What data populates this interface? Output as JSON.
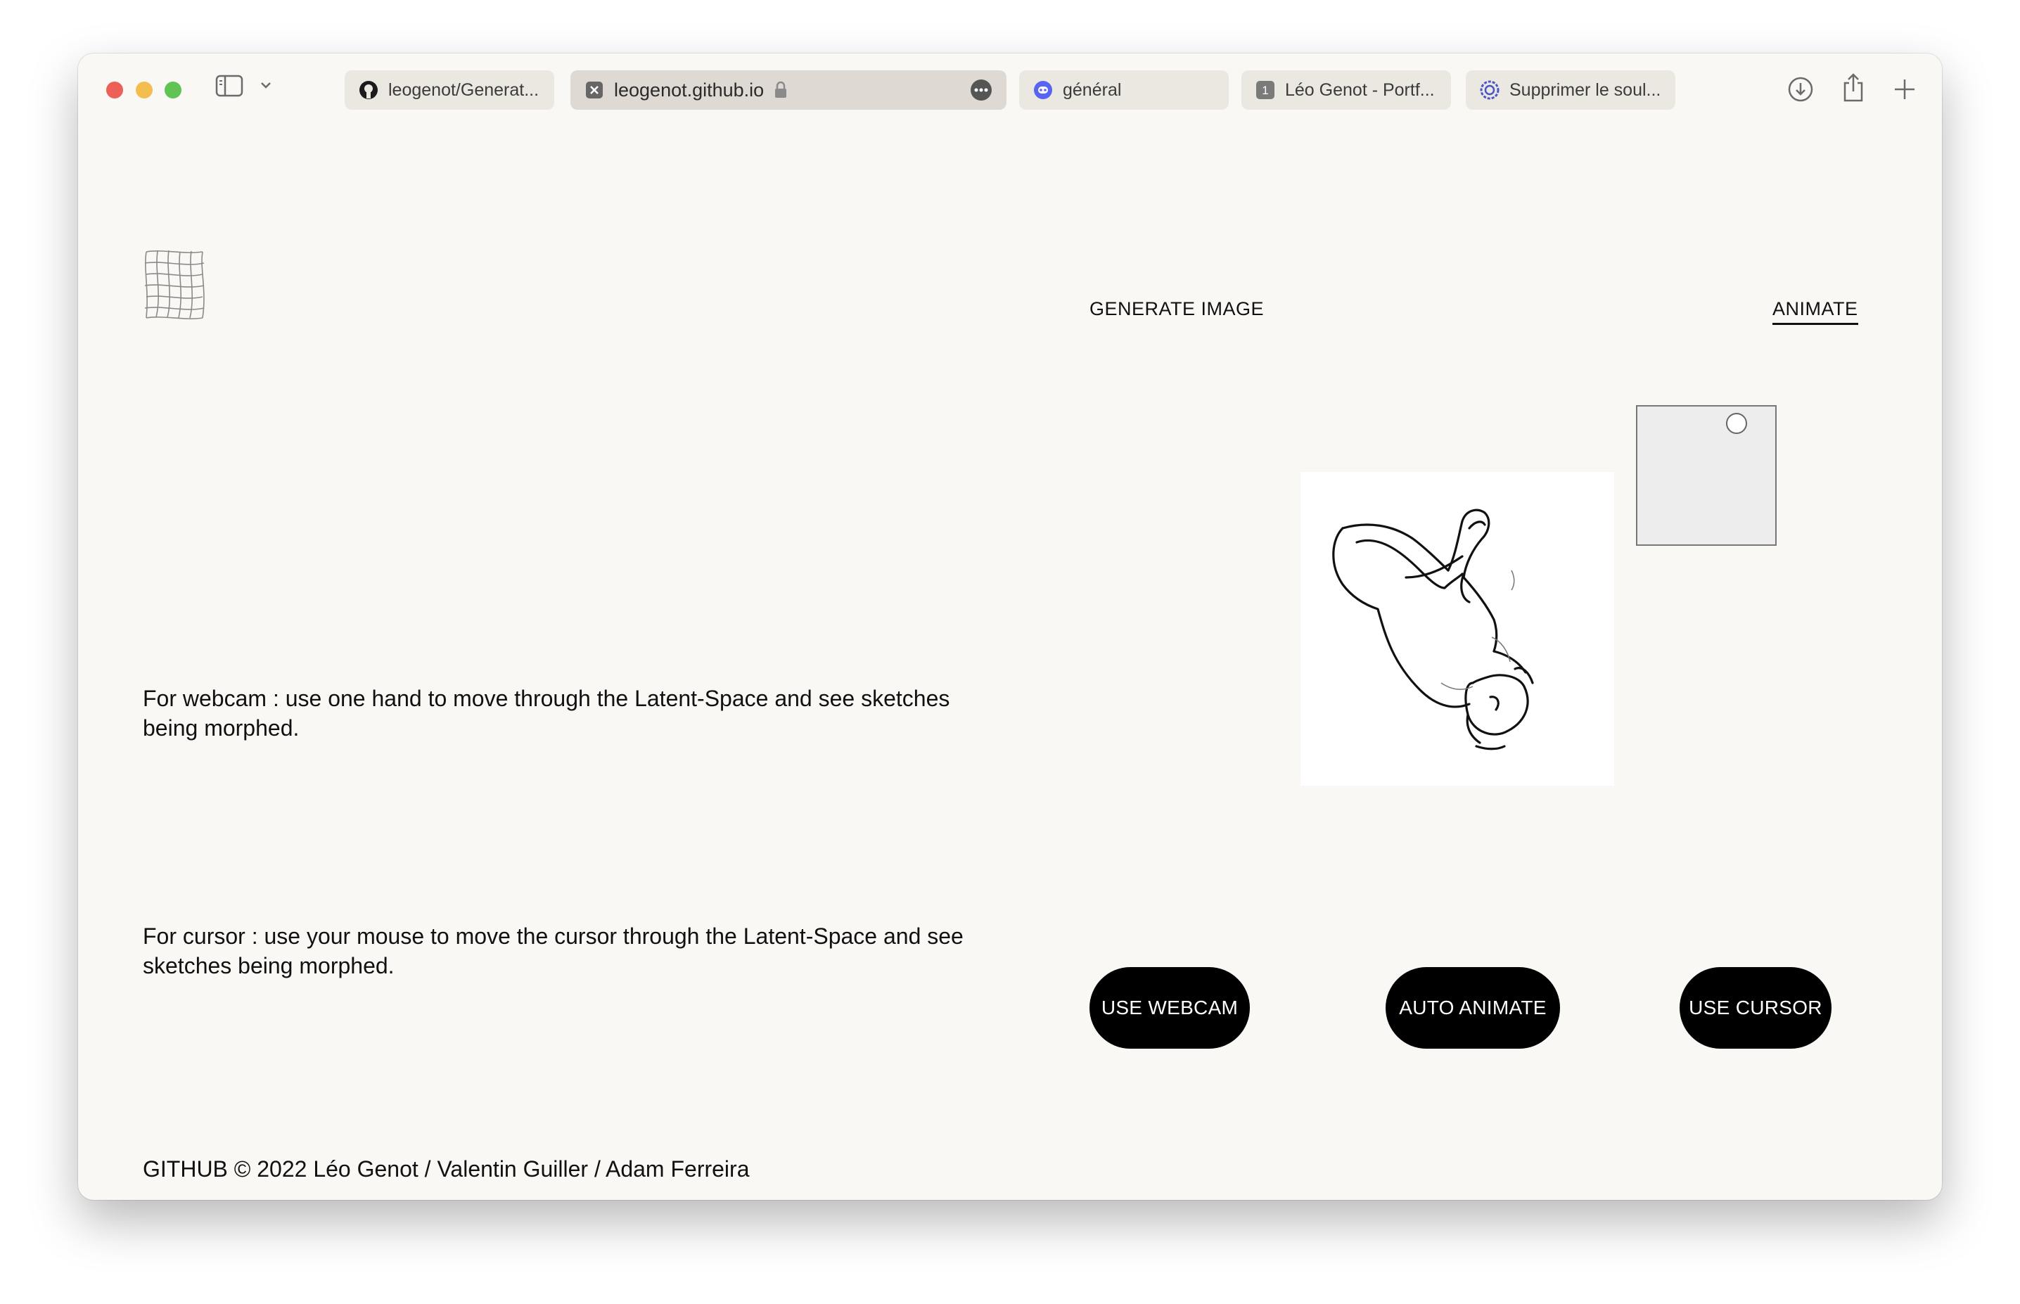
{
  "browser": {
    "tabs": [
      {
        "label": "leogenot/Generat...",
        "icon": "github-icon"
      },
      {
        "label": "leogenot.github.io",
        "icon": "close-tab-icon",
        "active": true
      },
      {
        "label": "général",
        "icon": "discord-icon"
      },
      {
        "label": "Léo Genot - Portf...",
        "icon": "number-badge-icon",
        "badge": "1"
      },
      {
        "label": "Supprimer le soul...",
        "icon": "gear-badge-icon"
      }
    ],
    "toolbar_icons": [
      "sidebar-icon",
      "chevron-down-icon",
      "download-icon",
      "share-icon",
      "plus-icon"
    ]
  },
  "nav": {
    "generate_label": "GENERATE IMAGE",
    "animate_label": "ANIMATE"
  },
  "instructions": {
    "webcam": "For webcam : use one hand to move through the Latent-Space and see sketches being morphed.",
    "cursor": "For cursor : use your mouse to move the cursor through the Latent-Space and see sketches being morphed."
  },
  "buttons": {
    "webcam": "USE WEBCAM",
    "auto": "AUTO ANIMATE",
    "cursor": "USE CURSOR"
  },
  "latent_space": {
    "cursor_position": [
      0.72,
      0.12
    ]
  },
  "footer": {
    "text": "GITHUB © 2022 Léo Genot / Valentin Guiller / Adam Ferreira"
  },
  "colors": {
    "background": "#faf8f4",
    "button": "#000000",
    "button_text": "#ffffff"
  }
}
